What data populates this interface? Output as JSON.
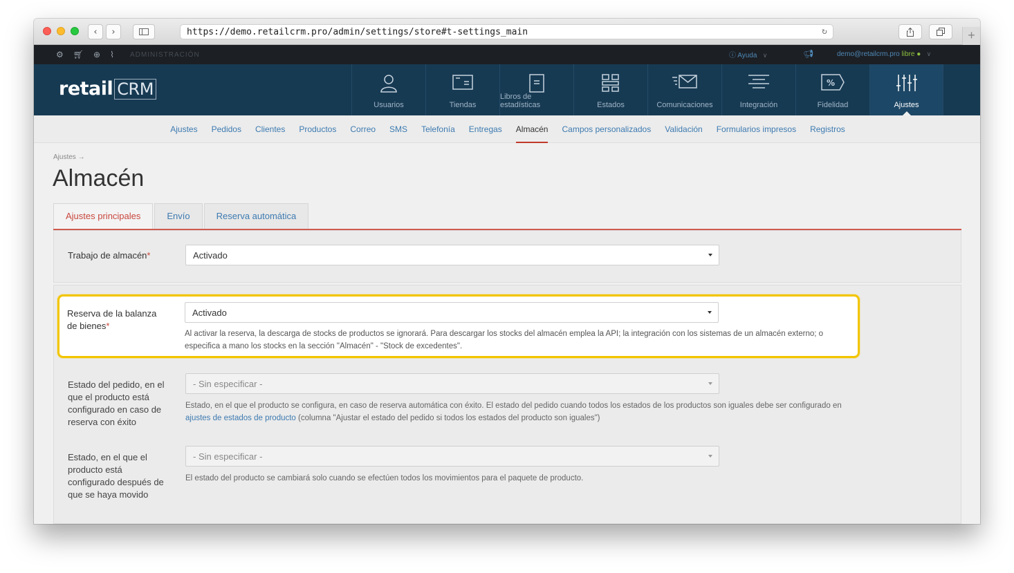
{
  "browser": {
    "url": "https://demo.retailcrm.pro/admin/settings/store#t-settings_main"
  },
  "adminbar": {
    "label": "ADMINISTRACIÓN",
    "help": "Ayuda",
    "user_email": "demo@retailcrm.pro",
    "user_status": "libre"
  },
  "header": {
    "logo_text": "retail",
    "logo_crm": "CRM",
    "nav": [
      {
        "label": "Usuarios",
        "icon": "user-icon"
      },
      {
        "label": "Tiendas",
        "icon": "store-icon"
      },
      {
        "label": "Libros de estadísticas",
        "icon": "document-icon"
      },
      {
        "label": "Estados",
        "icon": "grid-icon"
      },
      {
        "label": "Comunicaciones",
        "icon": "envelope-icon"
      },
      {
        "label": "Integración",
        "icon": "lines-icon"
      },
      {
        "label": "Fidelidad",
        "icon": "percent-tag-icon"
      },
      {
        "label": "Ajustes",
        "icon": "sliders-icon",
        "active": true
      }
    ]
  },
  "subnav": {
    "items": [
      "Ajustes",
      "Pedidos",
      "Clientes",
      "Productos",
      "Correo",
      "SMS",
      "Telefonía",
      "Entregas",
      "Almacén",
      "Campos personalizados",
      "Validación",
      "Formularios impresos",
      "Registros"
    ],
    "active": "Almacén"
  },
  "page": {
    "breadcrumb": "Ajustes →",
    "title": "Almacén",
    "tabs": [
      "Ajustes principales",
      "Envío",
      "Reserva automática"
    ],
    "active_tab": "Ajustes principales"
  },
  "form": {
    "warehouse_work": {
      "label": "Trabajo de almacén",
      "required_mark": "*",
      "value": "Activado"
    },
    "stock_reserve": {
      "label_line1": "Reserva de la balanza",
      "label_line2": "de bienes",
      "required_mark": "*",
      "value": "Activado",
      "hint_line1": "Al activar la reserva, la descarga de stocks de productos se ignorará. Para descargar los stocks del almacén emplea la API; la integración con los sistemas de un almacén externo; o",
      "hint_line2": "especifica a mano los stocks en la sección \"Almacén\" - \"Stock de excedentes\"."
    },
    "order_status": {
      "label_lines": [
        "Estado del pedido, en el",
        "que el producto está",
        "configurado en caso de",
        "reserva con éxito"
      ],
      "value": "- Sin especificar -",
      "hint_line1": "Estado, en el que el producto se configura, en caso de reserva automática con éxito. El estado del pedido cuando todos los estados de los productos son iguales debe ser configurado en",
      "hint_link": "ajustes de estados de producto",
      "hint_line2_rest": " (columna \"Ajustar el estado del pedido si todos los estados del producto son iguales\")"
    },
    "moved_status": {
      "label_lines": [
        "Estado, en el que el",
        "producto está",
        "configurado después de",
        "que se haya movido"
      ],
      "value": "- Sin especificar -",
      "hint": "El estado del producto se cambiará solo cuando se efectúen todos los movimientos para el paquete de producto."
    }
  },
  "colors": {
    "header_bg": "#173a53",
    "admin_bar_bg": "#1c1f24",
    "link": "#3d7ab0",
    "accent_red": "#c9473d",
    "highlight": "#f2c500"
  }
}
